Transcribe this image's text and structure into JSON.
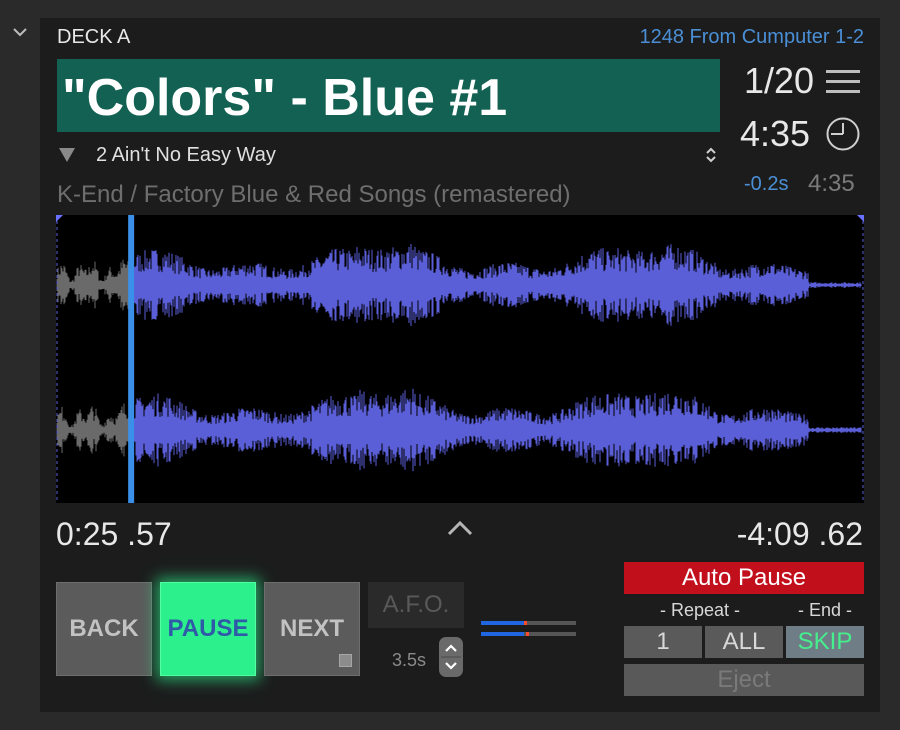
{
  "deck": {
    "name": "DECK A",
    "source": "1248 From Cumputer 1-2"
  },
  "current": {
    "title": "\"Colors\" - Blue #1",
    "position": "1/20",
    "duration": "4:35"
  },
  "next_track": {
    "label": "2 Ain't No Easy Way",
    "offset": "-0.2s",
    "duration": "4:35"
  },
  "album": "K-End / Factory Blue & Red Songs (remastered)",
  "playback": {
    "elapsed": "0:25 .57",
    "remaining": "-4:09 .62",
    "progress_fraction": 0.093
  },
  "controls": {
    "back_label": "BACK",
    "pause_label": "PAUSE",
    "next_label": "NEXT",
    "afo_label": "A.F.O.",
    "afo_time": "3.5s"
  },
  "meters": [
    {
      "level": 0.45,
      "peak": 0.45
    },
    {
      "level": 0.45,
      "peak": 0.47
    }
  ],
  "auto_pause": {
    "label": "Auto Pause",
    "repeat_label": "- Repeat -",
    "end_label": "- End -",
    "options": [
      "1",
      "ALL",
      "SKIP"
    ],
    "eject_label": "Eject"
  },
  "icons": {
    "collapse": "chevron-down-icon",
    "menu": "hamburger-menu-icon",
    "clock": "clock-icon",
    "next_expand": "triangle-down-icon",
    "stepper": "updown-stepper-icon",
    "expand": "chevron-up-icon"
  },
  "colors": {
    "title_bg": "#136152",
    "accent_blue": "#4a8fd6",
    "waveform_played": "#6a6a6a",
    "waveform_unplayed": "#5a5fd8",
    "playhead": "#3a8fe8",
    "pause_active": "#2cf08c",
    "auto_pause_bg": "#c20f1c",
    "skip_text": "#46ef8c"
  }
}
